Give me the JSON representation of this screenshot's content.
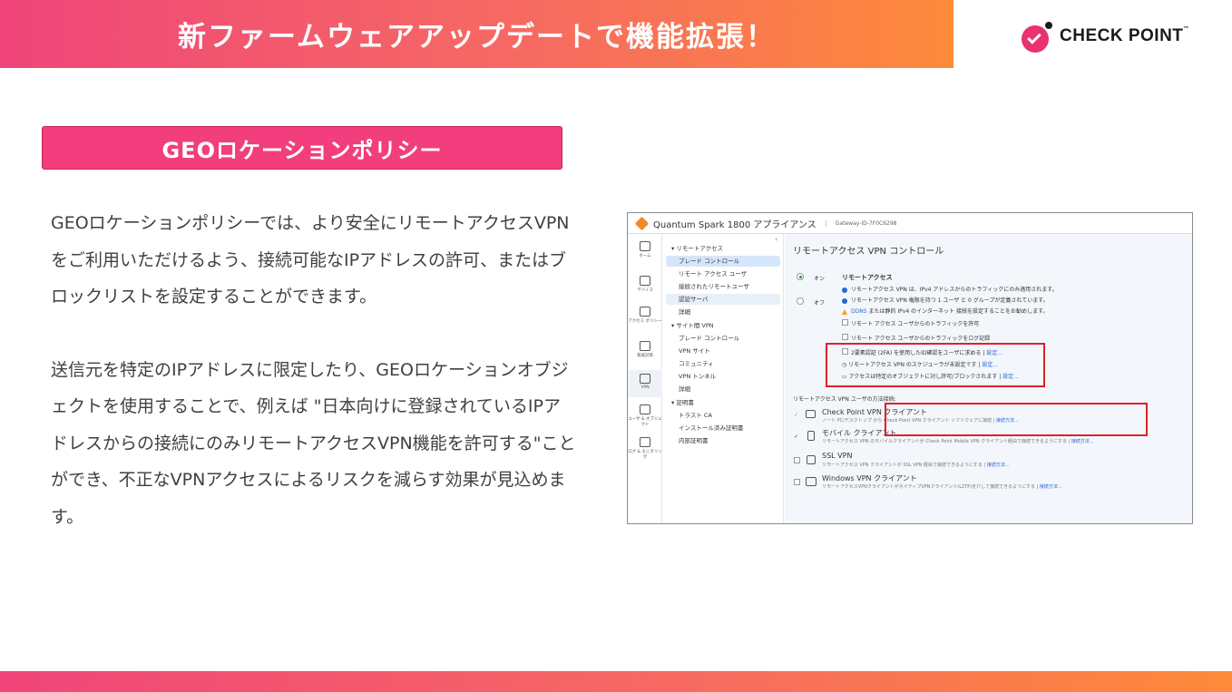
{
  "slide": {
    "title": "新ファームウェアアップデートで機能拡張！",
    "section_heading": "GEOロケーションポリシー",
    "paragraphs": [
      "GEOロケーションポリシーでは、より安全にリモートアクセスVPNをご利用いただけるよう、接続可能なIPアドレスの許可、またはブロックリストを設定することができます。",
      "送信元を特定のIPアドレスに限定したり、GEOロケーションオブジェクトを使用することで、例えば \"日本向けに登録されているIPアドレスからの接続にのみリモートアクセスVPN機能を許可する\"ことができ、不正なVPNアクセスによるリスクを減らす効果が見込めます。"
    ]
  },
  "logo": {
    "text": "CHECK POINT",
    "tm": "™"
  },
  "colors": {
    "accent_pink": "#f23e7d",
    "accent_orange": "#fd8a3a",
    "redbox": "#e0202a",
    "selected_blue": "#d6e6fa"
  },
  "screenshot": {
    "app_title": "Quantum Spark 1800 アプライアンス",
    "gateway": "Gateway-ID-7F0C6298",
    "nav": [
      {
        "label": "ホーム",
        "icon": "home-icon"
      },
      {
        "label": "デバイス",
        "icon": "device-icon"
      },
      {
        "label": "アクセス ポリシー",
        "icon": "access-policy-icon"
      },
      {
        "label": "脅威対策",
        "icon": "shield-icon"
      },
      {
        "label": "VPN",
        "icon": "vpn-icon"
      },
      {
        "label": "ユーザ & オブジェクト",
        "icon": "users-icon"
      },
      {
        "label": "ログ & モニタリング",
        "icon": "logs-icon"
      }
    ],
    "tree": {
      "remote_group": "リモートアクセス",
      "remote_items": [
        "ブレード コントロール",
        "リモート アクセス ユーザ",
        "接続されたリモートユーザ",
        "認証サーバ",
        "詳細"
      ],
      "site_group": "サイト間 VPN",
      "site_items": [
        "ブレード コントロール",
        "VPN サイト",
        "コミュニティ",
        "VPN トンネル",
        "詳細"
      ],
      "cert_group": "証明書",
      "cert_items": [
        "トラスト CA",
        "インストール済み証明書",
        "内部証明書"
      ]
    },
    "main": {
      "title": "リモートアクセス VPN コントロール",
      "on_label": "オン",
      "off_label": "オフ",
      "section_label": "リモートアクセス",
      "info1": "リモートアクセス VPN は、IPv4 アドレスからのトラフィックにのみ適用されます。",
      "info2": "リモートアクセス VPN 権限を持つ 1 ユーザ と 0 グループが定義されています。",
      "warn_prefix": "DDNS",
      "warn_text": "または静的 IPv4 のインターネット 接続を設定することをお勧めします。",
      "cb1": "リモート アクセス ユーザからのトラフィックを許可",
      "cb2": "リモート アクセス ユーザからのトラフィックをログ記録",
      "opt1": "2要素認証 (2FA) を使用したID確認をユーザに求める",
      "opt2": "リモートアクセス VPN のスケジューラが未設定です",
      "opt3": "アクセスは特定のオブジェクトに対し許可/ブロックされます",
      "settings_link": "設定...",
      "methods_label": "リモートアクセス VPN ユーザの方法接続:",
      "methods": [
        {
          "name": "Check Point VPN クライアント",
          "desc": "ノート PC/デスクトップ から Check Point VPN クライアント ソフトウェアに接続",
          "link": "接続方法..."
        },
        {
          "name": "モバイル クライアント",
          "desc": "リモートアクセス VPN のモバイルクライアントが Check Point Mobile VPN クライアント経由で接続できるようにする",
          "link": "接続方法..."
        },
        {
          "name": "SSL VPN",
          "desc": "リモートアクセス VPN クライアントが SSL VPN 経由で接続できるようにする",
          "link": "接続方法..."
        },
        {
          "name": "Windows VPN クライアント",
          "desc": "リモートアクセスVPNクライアントがネイティブVPNクライアント(L2TP)を介して接続できるようにする",
          "link": "接続方法..."
        }
      ]
    }
  }
}
